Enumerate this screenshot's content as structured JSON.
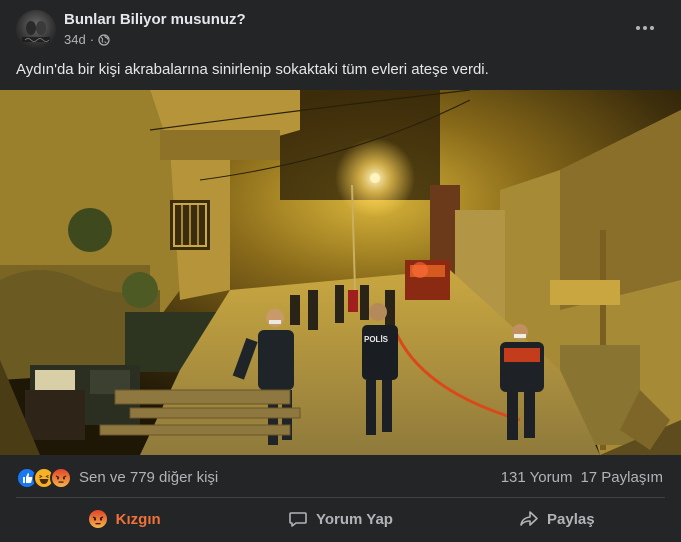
{
  "post": {
    "page_name": "Bunları Biliyor musunuz?",
    "time": "34d",
    "separator": "·",
    "text": "Aydın'da bir kişi akrabalarına sinirlenip sokaktaki tüm evleri ateşe verdi.",
    "photo_vest_text": "POLİS"
  },
  "reactions": {
    "icons": [
      "like-icon",
      "haha-icon",
      "angry-icon"
    ],
    "summary": "Sen ve 779 diğer kişi",
    "comments": "131 Yorum",
    "shares": "17 Paylaşım"
  },
  "actions": {
    "angry_label": "Kızgın",
    "comment_label": "Yorum Yap",
    "share_label": "Paylaş"
  },
  "colors": {
    "background": "#242526",
    "text_primary": "#e4e6eb",
    "text_secondary": "#b0b3b8",
    "angry_accent": "#f0713a",
    "like_blue": "#1877f2"
  }
}
